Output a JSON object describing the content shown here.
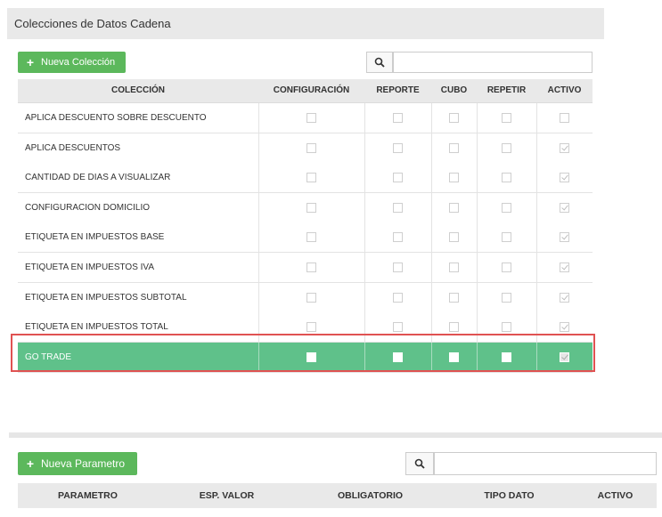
{
  "panel": {
    "title": "Colecciones de Datos Cadena"
  },
  "toolbar": {
    "new_collection_label": "Nueva Colección",
    "search_value": ""
  },
  "columns": [
    "COLECCIÓN",
    "CONFIGURACIÓN",
    "REPORTE",
    "CUBO",
    "REPETIR",
    "ACTIVO"
  ],
  "rows": [
    {
      "name": "APLICA DESCUENTO SOBRE DESCUENTO",
      "configuracion": false,
      "reporte": false,
      "cubo": false,
      "repetir": false,
      "activo": false
    },
    {
      "name": "APLICA DESCUENTOS",
      "configuracion": false,
      "reporte": false,
      "cubo": false,
      "repetir": false,
      "activo": true
    },
    {
      "name": "CANTIDAD DE DIAS A VISUALIZAR",
      "configuracion": false,
      "reporte": false,
      "cubo": false,
      "repetir": false,
      "activo": true
    },
    {
      "name": "CONFIGURACION DOMICILIO",
      "configuracion": false,
      "reporte": false,
      "cubo": false,
      "repetir": false,
      "activo": true
    },
    {
      "name": "ETIQUETA EN IMPUESTOS BASE",
      "configuracion": false,
      "reporte": false,
      "cubo": false,
      "repetir": false,
      "activo": true
    },
    {
      "name": "ETIQUETA EN IMPUESTOS IVA",
      "configuracion": false,
      "reporte": false,
      "cubo": false,
      "repetir": false,
      "activo": true
    },
    {
      "name": "ETIQUETA EN IMPUESTOS SUBTOTAL",
      "configuracion": false,
      "reporte": false,
      "cubo": false,
      "repetir": false,
      "activo": true
    },
    {
      "name": "ETIQUETA EN IMPUESTOS TOTAL",
      "configuracion": false,
      "reporte": false,
      "cubo": false,
      "repetir": false,
      "activo": true
    },
    {
      "name": "GO TRADE",
      "configuracion": false,
      "reporte": false,
      "cubo": false,
      "repetir": false,
      "activo": true,
      "selected": true
    }
  ],
  "params": {
    "new_param_label": "Nueva Parametro",
    "search_value": "",
    "columns": [
      "PARAMETRO",
      "ESP. VALOR",
      "OBLIGATORIO",
      "TIPO DATO",
      "ACTIVO"
    ]
  },
  "icons": {
    "add": "plus-icon",
    "search": "search-icon",
    "check": "checkbox-icon"
  },
  "colors": {
    "accent_green": "#5cb85c",
    "selected_row": "#5fc18a",
    "highlight_border": "#e05252"
  }
}
